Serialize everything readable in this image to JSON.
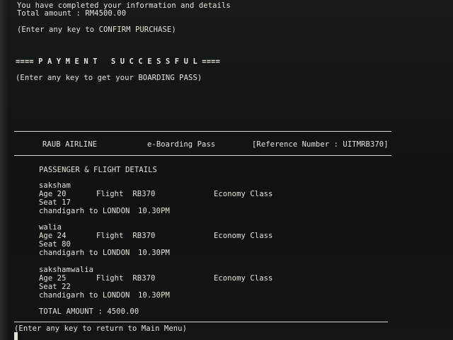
{
  "terminal": {
    "completed_msg": "You have completed your information and details",
    "total_amount_line": "Total amount : RM4500.00",
    "confirm_prompt": "(Enter any key to CONFIRM PURCHASE)",
    "payment_banner": "==== P A Y M E N T   S U C C E S S F U L ====",
    "boarding_prompt": "(Enter any key to get your BOARDING PASS)",
    "return_prompt": "(Enter any key to return to Main Menu)"
  },
  "boarding_pass": {
    "airline": "RAUB AIRLINE",
    "title": "e-Boarding Pass",
    "reference": "[Reference Number : UITMRB370]",
    "section_heading": "PASSENGER & FLIGHT DETAILS",
    "passengers": [
      {
        "name": "saksham",
        "age": "Age 20",
        "flight": "Flight  RB370",
        "class": "Economy Class",
        "seat": "Seat 17",
        "route": "chandigarh to LONDON",
        "time": "10.30PM"
      },
      {
        "name": "walia",
        "age": "Age 24",
        "flight": "Flight  RB370",
        "class": "Economy Class",
        "seat": "Seat 80",
        "route": "chandigarh to LONDON",
        "time": "10.30PM"
      },
      {
        "name": "sakshamwalia",
        "age": "Age 25",
        "flight": "Flight  RB370",
        "class": "Economy Class",
        "seat": "Seat 22",
        "route": "chandigarh to LONDON",
        "time": "10.30PM"
      }
    ],
    "total_amount": "TOTAL AMOUNT : 4500.00"
  }
}
